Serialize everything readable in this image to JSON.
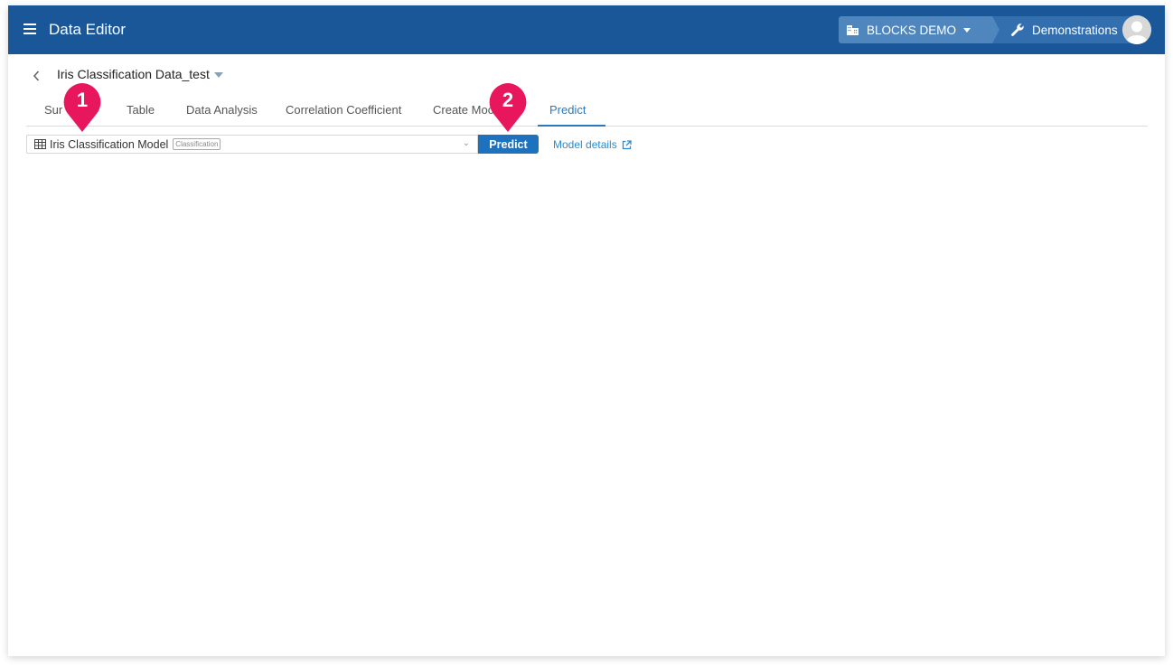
{
  "app": {
    "title": "Data Editor",
    "menu_icon": "hamburger-menu-icon"
  },
  "header": {
    "organization": {
      "label": "BLOCKS DEMO",
      "icon": "building-icon"
    },
    "project": {
      "label": "Demonstrations",
      "icon": "wrench-icon"
    },
    "avatar_icon": "user-avatar-icon"
  },
  "dataset": {
    "title": "Iris Classification Data_test",
    "back_icon": "chevron-left-icon"
  },
  "tabs": [
    {
      "label": "Summary",
      "visible_label": "Sur",
      "active": false
    },
    {
      "label": "Table",
      "active": false
    },
    {
      "label": "Data Analysis",
      "active": false
    },
    {
      "label": "Correlation Coefficient",
      "active": false
    },
    {
      "label": "Create Model",
      "visible_label": "Create Moc",
      "active": false
    },
    {
      "label": "Predict",
      "active": true
    }
  ],
  "predict_form": {
    "model_select": {
      "value": "Iris Classification Model",
      "badge": "Classification",
      "icon": "table-icon"
    },
    "predict_button": "Predict",
    "model_details_link": "Model details",
    "external_link_icon": "external-link-icon"
  },
  "annotations": [
    {
      "number": "1",
      "target": "model-select"
    },
    {
      "number": "2",
      "target": "predict-button"
    }
  ],
  "colors": {
    "appbar": "#1a5799",
    "accent": "#2a79bf",
    "button": "#1e72bd",
    "marker": "#e8175d"
  }
}
